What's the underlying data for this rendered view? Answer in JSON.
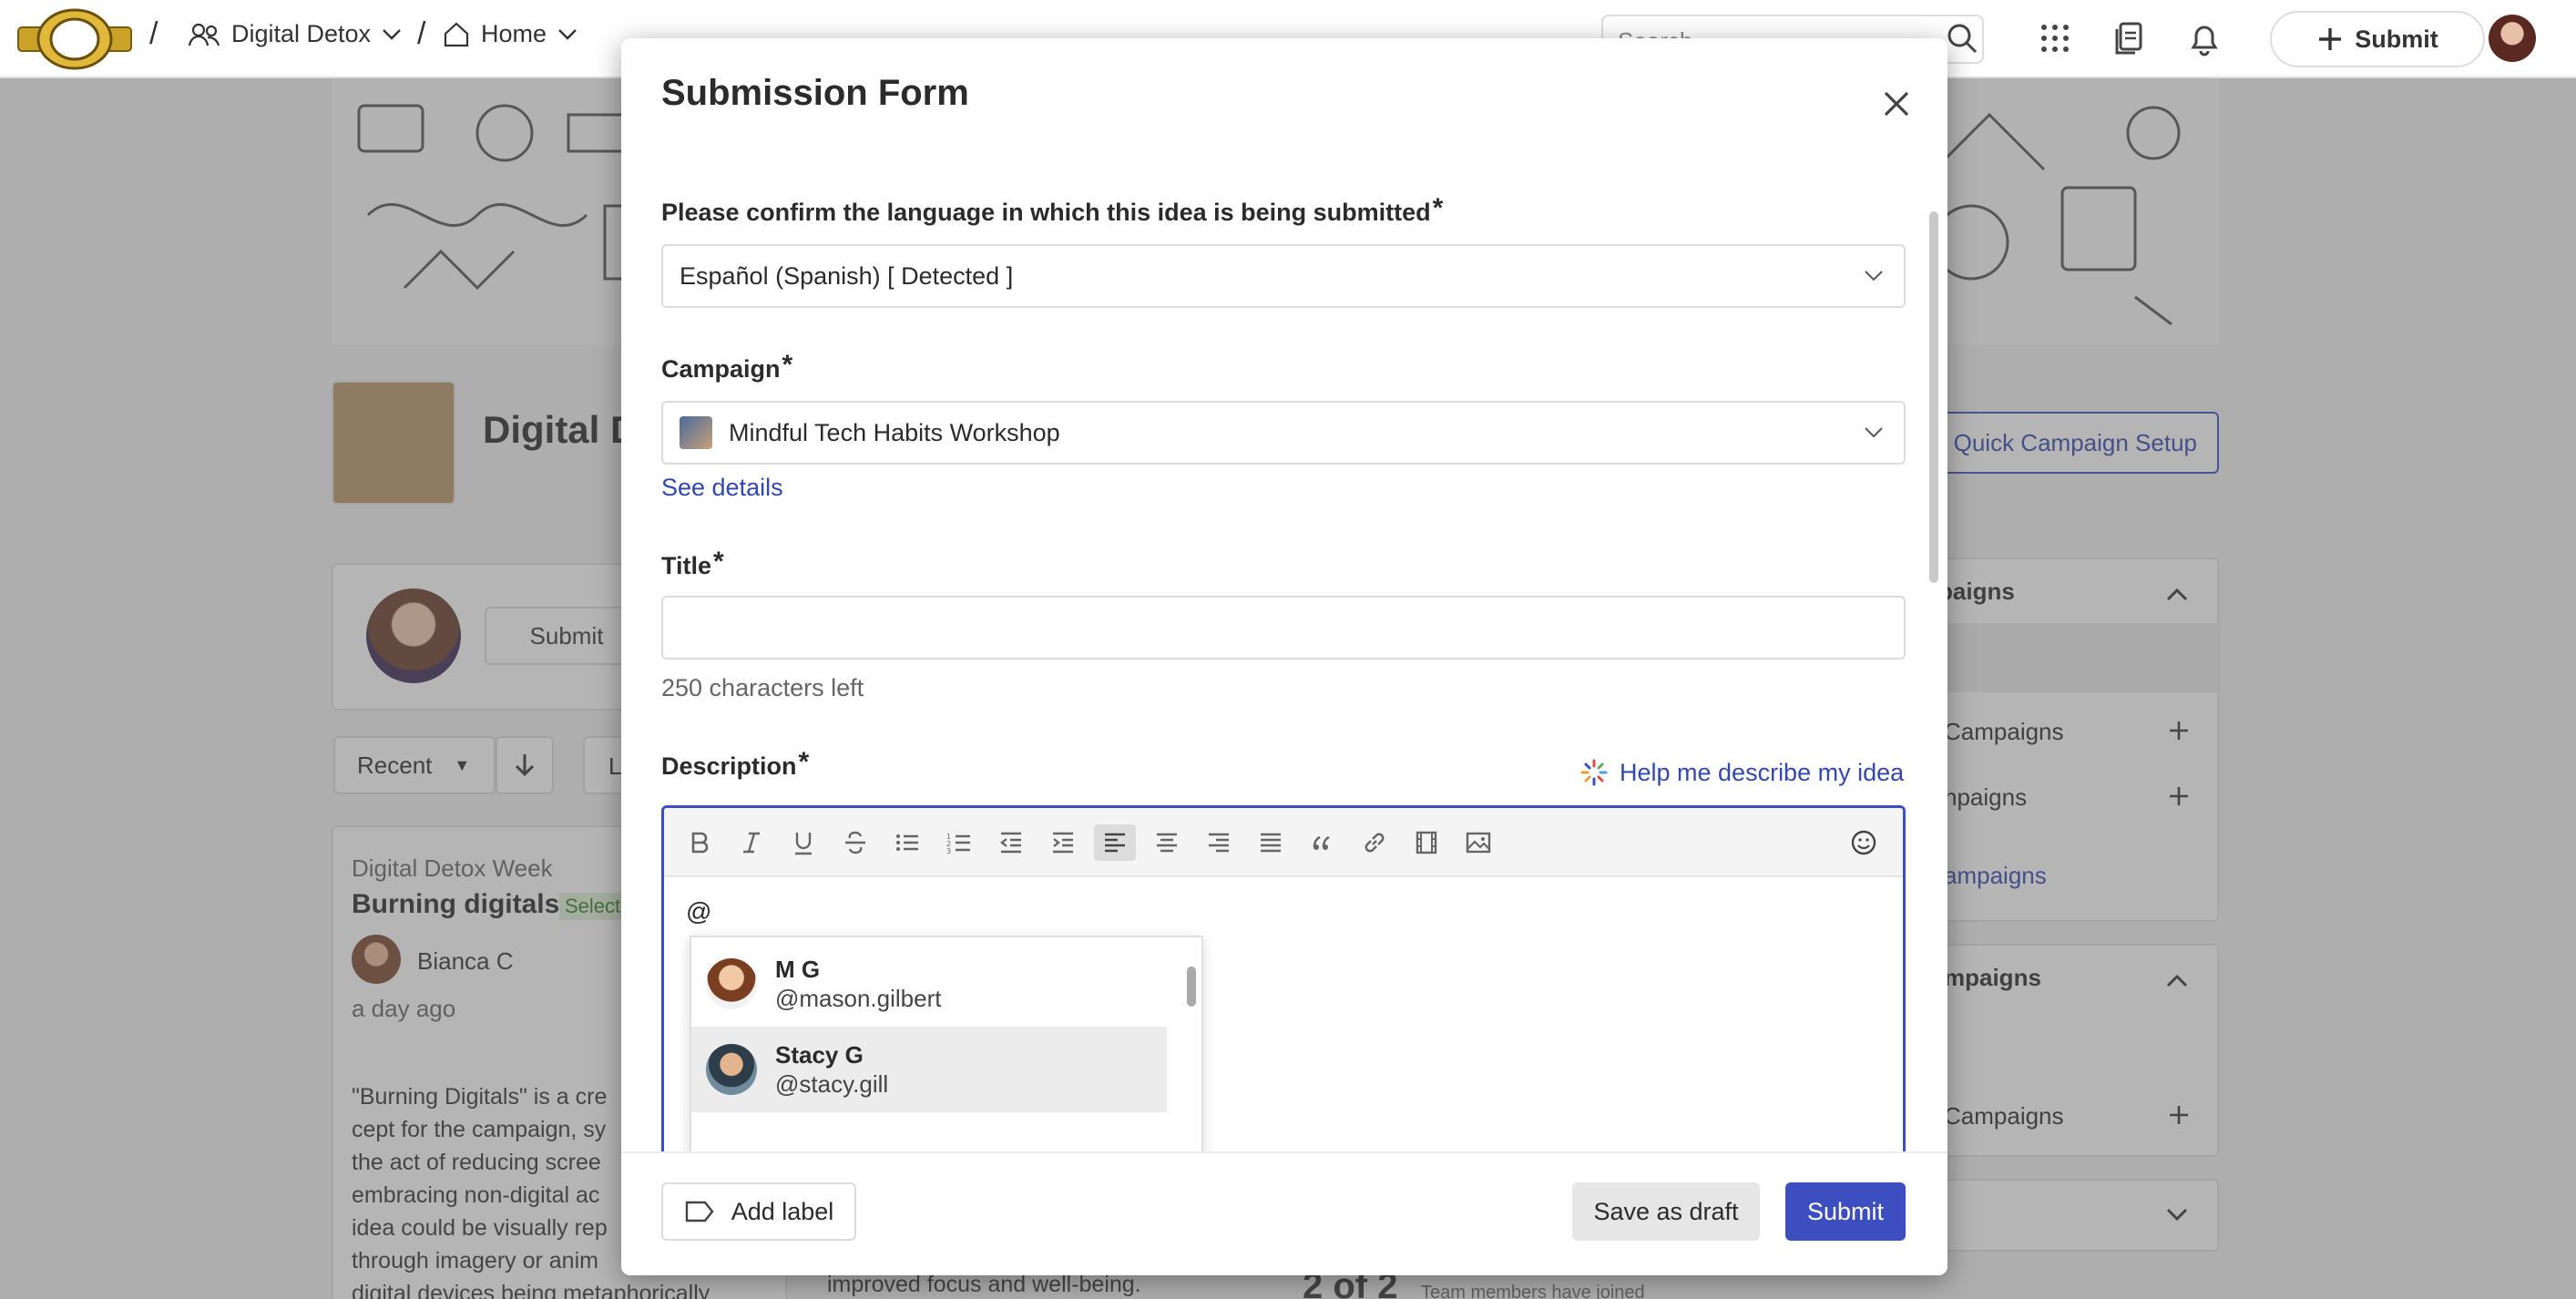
{
  "nav": {
    "workspace": "Digital Detox",
    "home": "Home",
    "search_placeholder": "Search",
    "submit_label": "Submit",
    "separator": "/"
  },
  "background": {
    "campaign_title": "Digital D",
    "quick_setup_label": "Quick Campaign Setup",
    "composer_submit": "Submit",
    "sort_label": "Recent",
    "filter_label": "L",
    "idea_campaign": "Digital Detox Week",
    "idea_title": "Burning digitals",
    "idea_badge": "Selecte",
    "idea_author": "Bianca C",
    "idea_time": "a day ago",
    "idea_excerpt": [
      "\"Burning Digitals\" is a cre",
      "cept for the campaign, sy",
      "the act of reducing scree",
      "embracing non-digital ac",
      "idea could be visually rep",
      "through imagery or anim",
      "digital devices being metaphorically"
    ],
    "middle_excerpt": "improved focus and well-being.",
    "counter": "2 of 2",
    "counter_note": "Team members have joined",
    "side_panel": {
      "section1_title": "paigns",
      "item1": "Campaigns",
      "item2": "npaigns",
      "link": "ampaigns",
      "section2_title": "mpaigns",
      "item3": "Campaigns"
    }
  },
  "modal": {
    "title": "Submission Form",
    "language_label": "Please confirm the language in which this idea is being submitted",
    "language_value": "Español (Spanish) [ Detected ]",
    "campaign_label": "Campaign",
    "campaign_value": "Mindful Tech Habits Workshop",
    "see_details": "See details",
    "title_label": "Title",
    "title_value": "",
    "chars_left": "250 characters left",
    "description_label": "Description",
    "help_link": "Help me describe my idea",
    "required_mark": "*",
    "editor_text": "@",
    "mentions": [
      {
        "name": "M G",
        "handle": "@mason.gilbert"
      },
      {
        "name": "Stacy G",
        "handle": "@stacy.gill"
      }
    ],
    "add_label": "Add label",
    "save_draft": "Save as draft",
    "submit": "Submit"
  },
  "colors": {
    "accent": "#3d4fc0",
    "link": "#3347b0",
    "badge_green": "#dff3d6"
  }
}
